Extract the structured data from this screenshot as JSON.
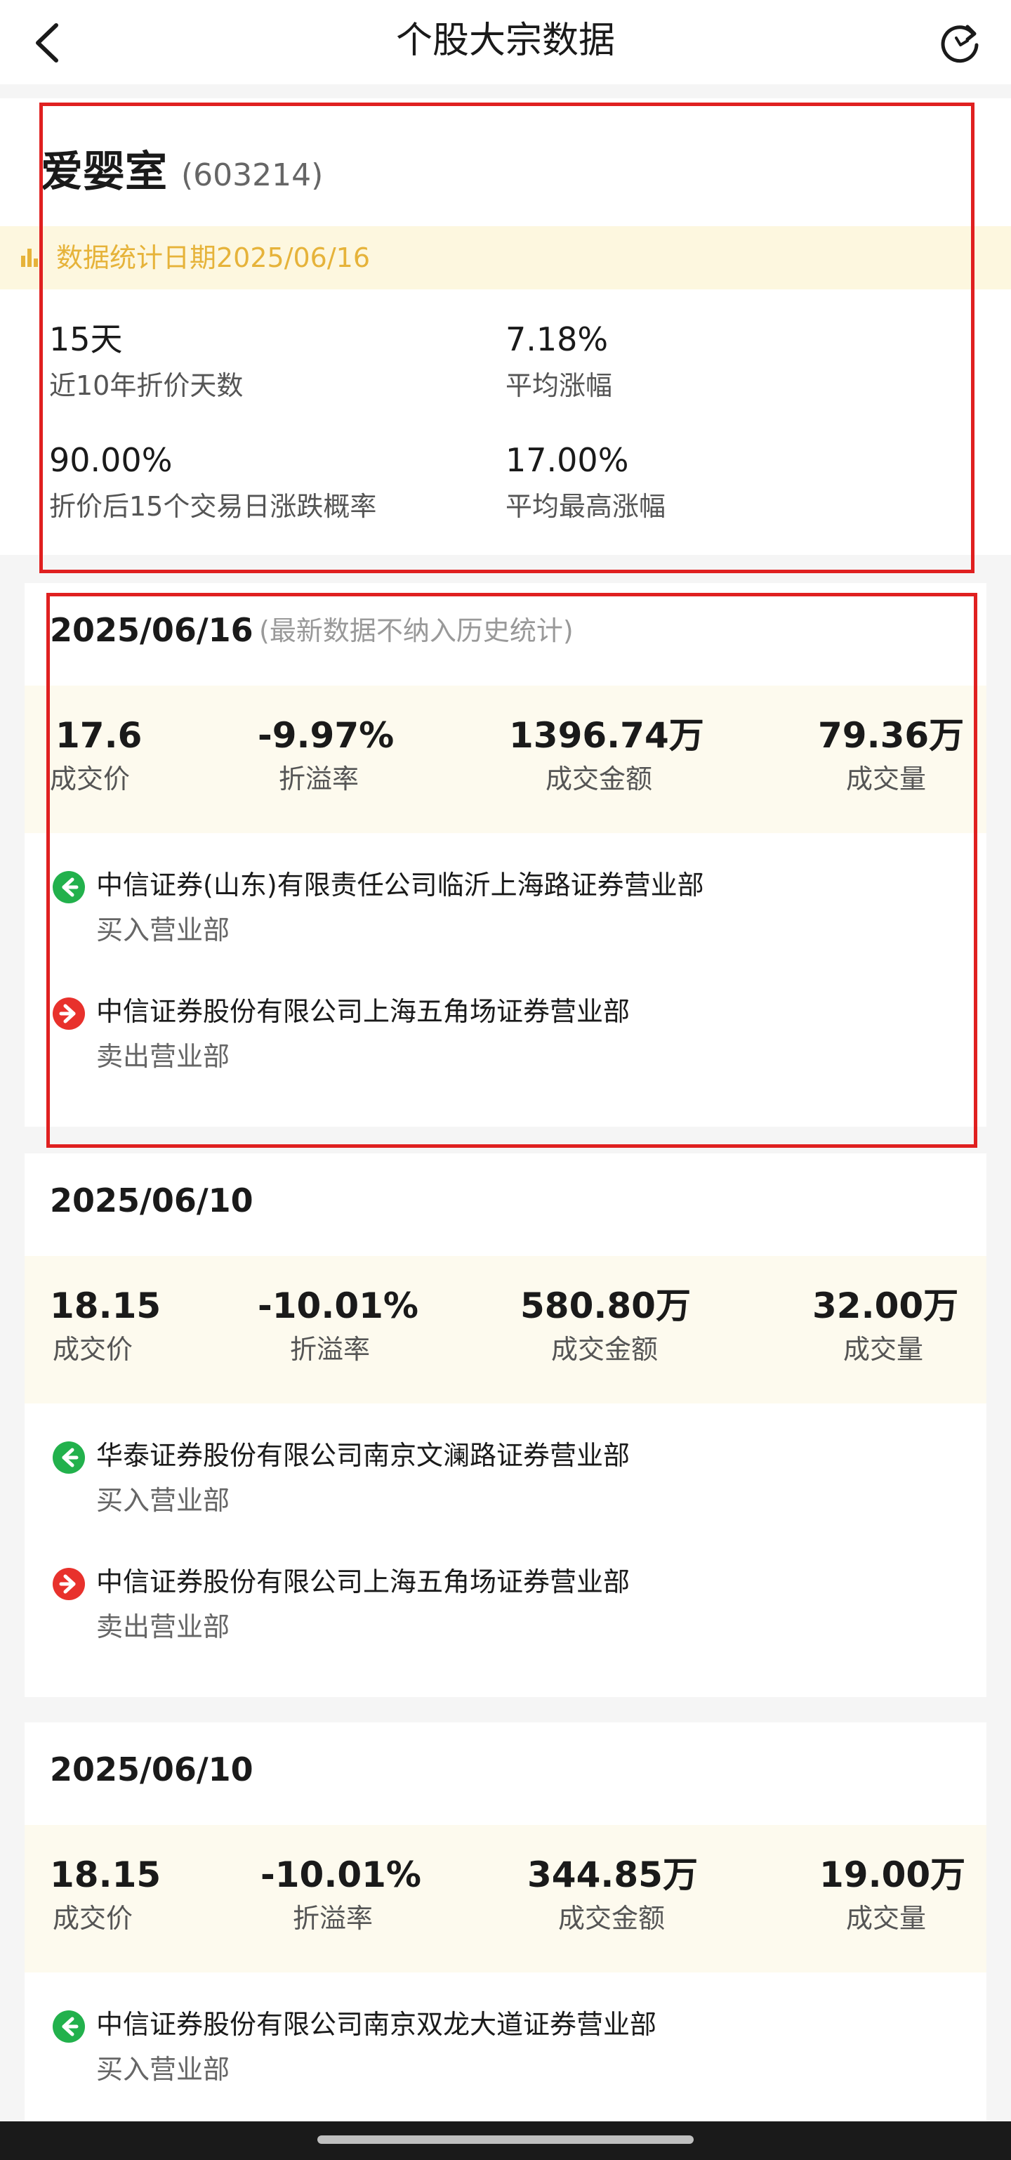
{
  "navbar": {
    "title": "个股大宗数据",
    "back_icon": "chevron-left-icon",
    "refresh_icon": "refresh-icon"
  },
  "stock": {
    "name": "爱婴室",
    "code": "(603214)"
  },
  "stats": {
    "date_label": "数据统计日期2025/06/16",
    "metrics": [
      {
        "value": "15天",
        "label": "近10年折价天数"
      },
      {
        "value": "7.18%",
        "label": "平均涨幅"
      },
      {
        "value": "90.00%",
        "label": "折价后15个交易日涨跌概率"
      },
      {
        "value": "17.00%",
        "label": "平均最高涨幅"
      }
    ]
  },
  "colors": {
    "accent_gold": "#e6b33a",
    "buy_green": "#22b14c",
    "sell_red": "#e8312c",
    "highlight_border": "#e02020"
  },
  "labels": {
    "price": "成交价",
    "premium": "折溢率",
    "amount": "成交金额",
    "volume": "成交量",
    "buy_dept": "买入营业部",
    "sell_dept": "卖出营业部"
  },
  "trades": [
    {
      "date": "2025/06/16",
      "note": "(最新数据不纳入历史统计)",
      "price": "17.6",
      "premium": "-9.97%",
      "amount": "1396.74万",
      "volume": "79.36万",
      "buyer": "中信证券(山东)有限责任公司临沂上海路证券营业部",
      "seller": "中信证券股份有限公司上海五角场证券营业部"
    },
    {
      "date": "2025/06/10",
      "price": "18.15",
      "premium": "-10.01%",
      "amount": "580.80万",
      "volume": "32.00万",
      "buyer": "华泰证券股份有限公司南京文澜路证券营业部",
      "seller": "中信证券股份有限公司上海五角场证券营业部"
    },
    {
      "date": "2025/06/10",
      "price": "18.15",
      "premium": "-10.01%",
      "amount": "344.85万",
      "volume": "19.00万",
      "buyer": "中信证券股份有限公司南京双龙大道证券营业部"
    }
  ]
}
